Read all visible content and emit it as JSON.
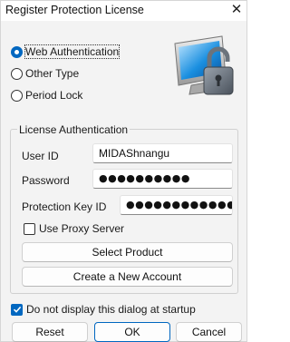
{
  "window": {
    "title": "Register Protection License",
    "close_glyph": "✕"
  },
  "license_type": {
    "options": [
      {
        "label": "Web Authentication",
        "checked": true
      },
      {
        "label": "Other Type",
        "checked": false
      },
      {
        "label": "Period Lock",
        "checked": false
      }
    ]
  },
  "auth_group": {
    "title": "License Authentication",
    "user_id": {
      "label": "User ID",
      "value": "MIDAShnangu"
    },
    "password": {
      "label": "Password",
      "value": "●●●●●●●●●●"
    },
    "protection_key": {
      "label": "Protection Key ID",
      "value": "●●●●●●●●●●●●●●●●●"
    },
    "use_proxy": {
      "label": "Use Proxy Server",
      "checked": false
    },
    "select_product_label": "Select Product",
    "create_account_label": "Create a New Account"
  },
  "startup": {
    "label": "Do not display this dialog at startup",
    "checked": true
  },
  "footer": {
    "reset_label": "Reset",
    "ok_label": "OK",
    "cancel_label": "Cancel"
  },
  "icons": {
    "logo": "monitor-padlock-icon",
    "close": "close-icon",
    "check": "checkmark-icon"
  },
  "colors": {
    "accent": "#0067c0",
    "dialog_bg": "#f3f3f3"
  }
}
